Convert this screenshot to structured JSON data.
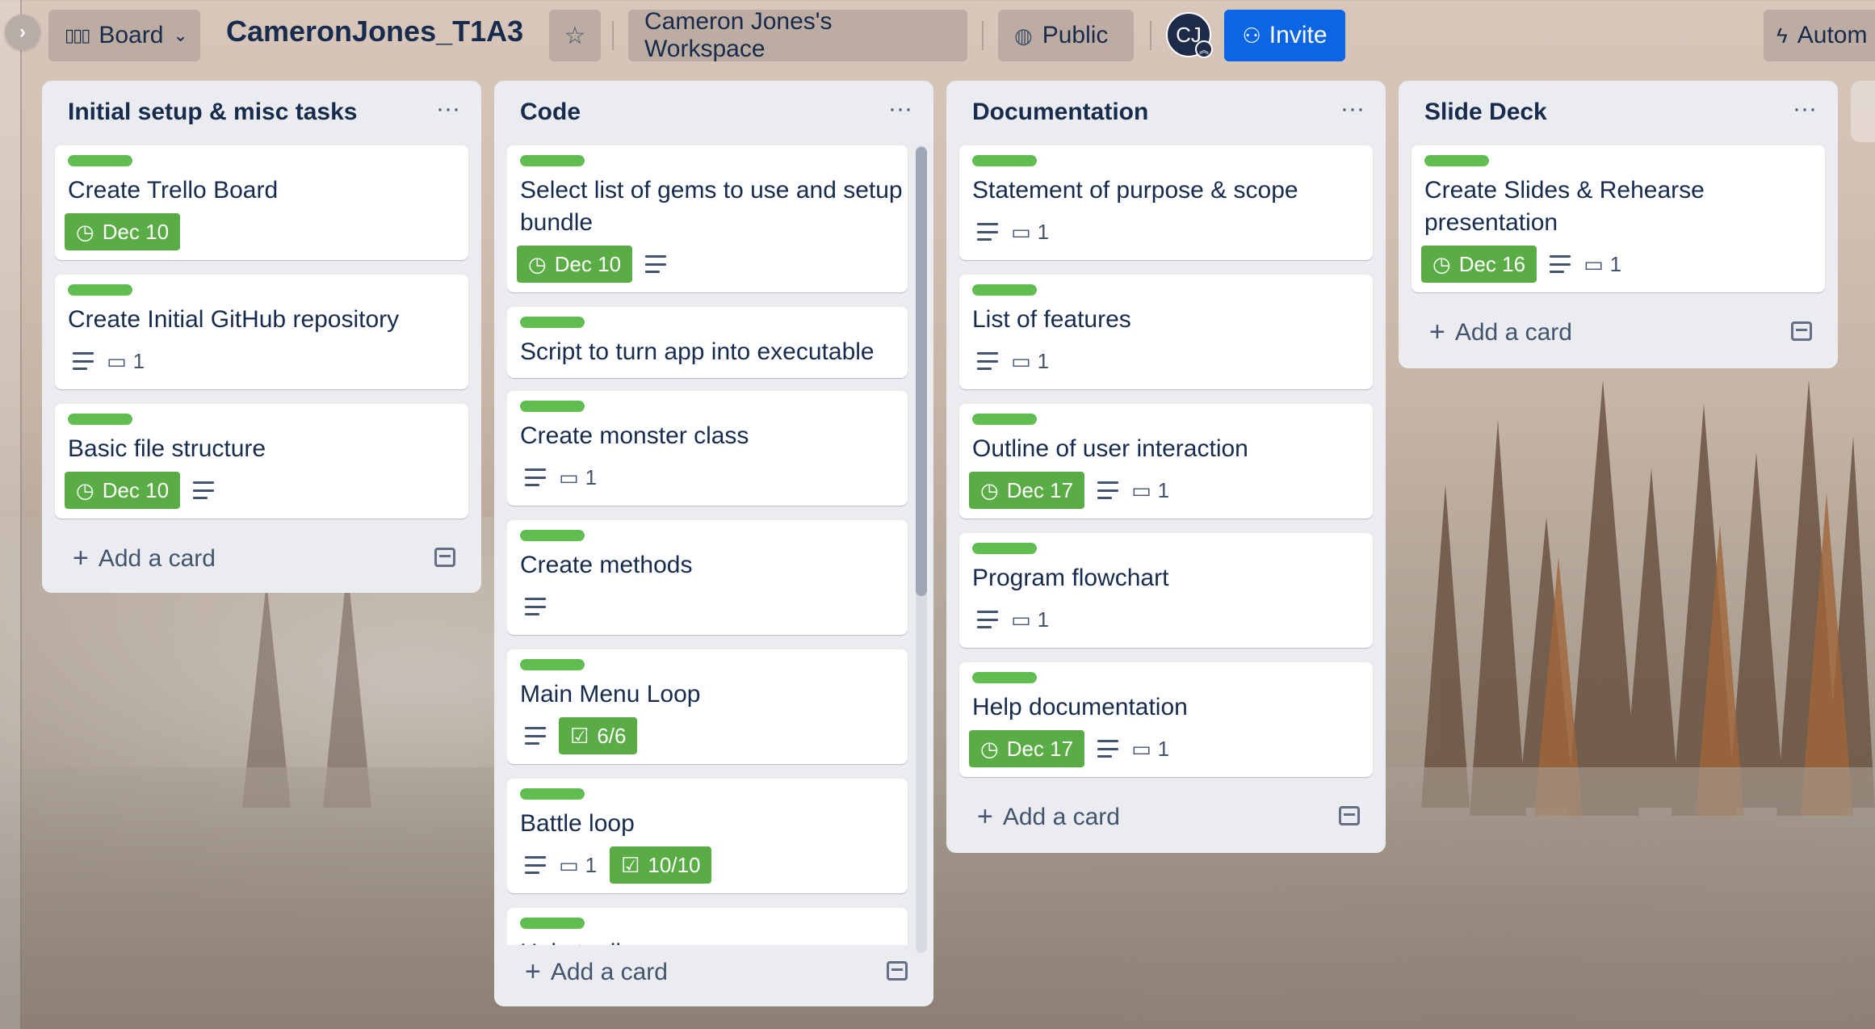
{
  "header": {
    "board_view_label": "Board",
    "board_title": "CameronJones_T1A3",
    "workspace_label": "Cameron Jones's Workspace",
    "visibility_label": "Public",
    "avatar_initials": "CJ",
    "invite_label": "Invite",
    "automation_label": "Autom"
  },
  "colors": {
    "label_green": "#61bd4f",
    "badge_green": "#5aac44",
    "invite_blue": "#0c66e4",
    "list_bg": "#ebecf0"
  },
  "lists": [
    {
      "name": "Initial setup & misc tasks",
      "add_card_label": "Add a card",
      "cards": [
        {
          "title": "Create Trello Board",
          "due": "Dec 10"
        },
        {
          "title": "Create Initial GitHub repository",
          "comments": "1"
        },
        {
          "title": "Basic file structure",
          "due": "Dec 10"
        }
      ]
    },
    {
      "name": "Code",
      "add_card_label": "Add a card",
      "cards": [
        {
          "title_line1": "Select list of gems to use and setup",
          "title_line2": "bundle",
          "due": "Dec 10"
        },
        {
          "title": "Script to turn app into executable"
        },
        {
          "title": "Create monster class",
          "comments": "1"
        },
        {
          "title": "Create methods"
        },
        {
          "title": "Main Menu Loop",
          "checklist": "6/6"
        },
        {
          "title": "Battle loop",
          "comments": "1",
          "checklist": "10/10"
        },
        {
          "title": "Help toolbar"
        }
      ]
    },
    {
      "name": "Documentation",
      "add_card_label": "Add a card",
      "cards": [
        {
          "title": "Statement of purpose & scope",
          "comments": "1"
        },
        {
          "title": "List of features",
          "comments": "1"
        },
        {
          "title": "Outline of user interaction",
          "due": "Dec 17",
          "comments": "1"
        },
        {
          "title": "Program flowchart",
          "comments": "1"
        },
        {
          "title": "Help documentation",
          "due": "Dec 17",
          "comments": "1"
        }
      ]
    },
    {
      "name": "Slide Deck",
      "add_card_label": "Add a card",
      "cards": [
        {
          "title_line1": "Create Slides & Rehearse",
          "title_line2": "presentation",
          "due": "Dec 16",
          "comments": "1"
        }
      ]
    }
  ]
}
